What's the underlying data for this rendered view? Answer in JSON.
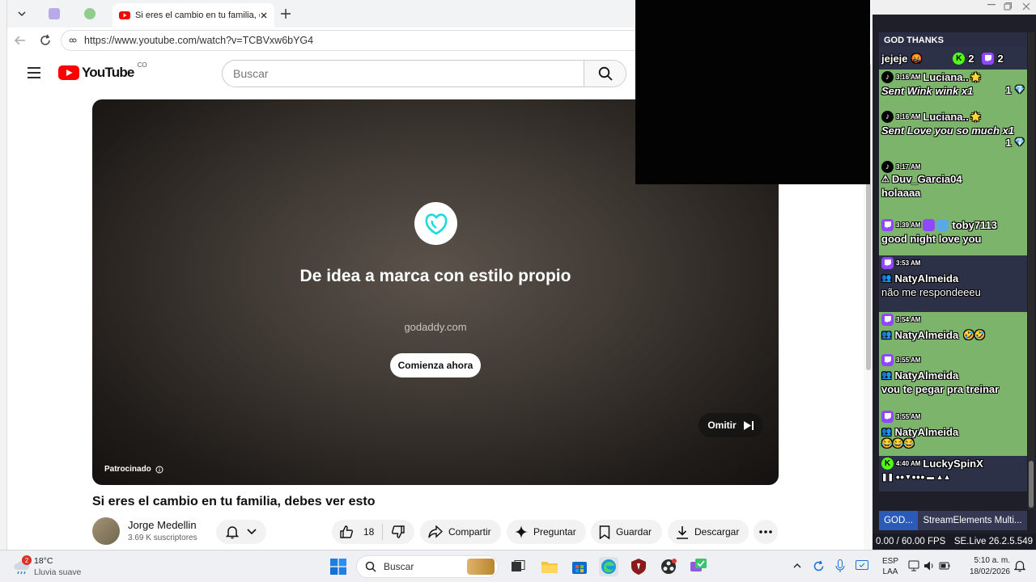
{
  "browser": {
    "active_tab_title": "Si eres el cambio en tu familia, debes ver esto",
    "url": "https://www.youtube.com/watch?v=TCBVxw6bYG4"
  },
  "youtube": {
    "logo_text": "YouTube",
    "country": "CO",
    "search_placeholder": "Buscar",
    "ad": {
      "headline": "De idea a marca con estilo propio",
      "domain": "godaddy.com",
      "cta": "Comienza ahora",
      "skip": "Omitir",
      "sponsored": "Patrocinado"
    },
    "video_title": "Si eres el cambio en tu familia, debes ver esto",
    "channel_name": "Jorge Medellin",
    "subscribers": "3.69 K suscriptores",
    "likes": "18",
    "share": "Compartir",
    "ask": "Preguntar",
    "save": "Guardar",
    "download": "Descargar"
  },
  "chat": {
    "header": "GOD THANKS",
    "top_line": "jejeje",
    "kick_count": "2",
    "twitch_count": "2",
    "messages": [
      {
        "platform": "tiktok",
        "time": "3:16 AM",
        "user": "Luciana..",
        "text": "Sent Wink wink x1",
        "count": "1",
        "bg": "green"
      },
      {
        "platform": "tiktok",
        "time": "3:16 AM",
        "user": "Luciana..",
        "text": "Sent Love you so much x1",
        "count": "1",
        "bg": "green"
      },
      {
        "platform": "tiktok",
        "time": "3:17 AM",
        "user": "Duv_Garcia04",
        "text": "holaaaa",
        "bg": "green"
      },
      {
        "platform": "twitch",
        "time": "3:39 AM",
        "user": "toby7113",
        "text": "good night love you",
        "bg": "green"
      },
      {
        "platform": "twitch",
        "time": "3:53 AM",
        "user": "NatyAlmeida",
        "text": "não me respondeeeu",
        "bg": "dark"
      },
      {
        "platform": "twitch",
        "time": "3:54 AM",
        "user": "NatyAlmeida",
        "text": "",
        "bg": "green"
      },
      {
        "platform": "twitch",
        "time": "3:55 AM",
        "user": "NatyAlmeida",
        "text": "vou te pegar pra treinar",
        "bg": "green"
      },
      {
        "platform": "twitch",
        "time": "3:55 AM",
        "user": "NatyAlmeida",
        "text": "",
        "bg": "green"
      },
      {
        "platform": "kick",
        "time": "4:40 AM",
        "user": "LuckySpinX",
        "text": "",
        "bg": "dark"
      }
    ],
    "tab_1": "GOD...",
    "tab_2": "StreamElements Multi...",
    "fps": "0.00 / 60.00 FPS",
    "version": "SE.Live 26.2.5.549"
  },
  "taskbar": {
    "weather_badge": "2",
    "temperature": "18°C",
    "condition": "Lluvia suave",
    "search": "Buscar",
    "lang_1": "ESP",
    "lang_2": "LAA",
    "time": "5:10 a. m.",
    "date": "18/02/2026"
  }
}
